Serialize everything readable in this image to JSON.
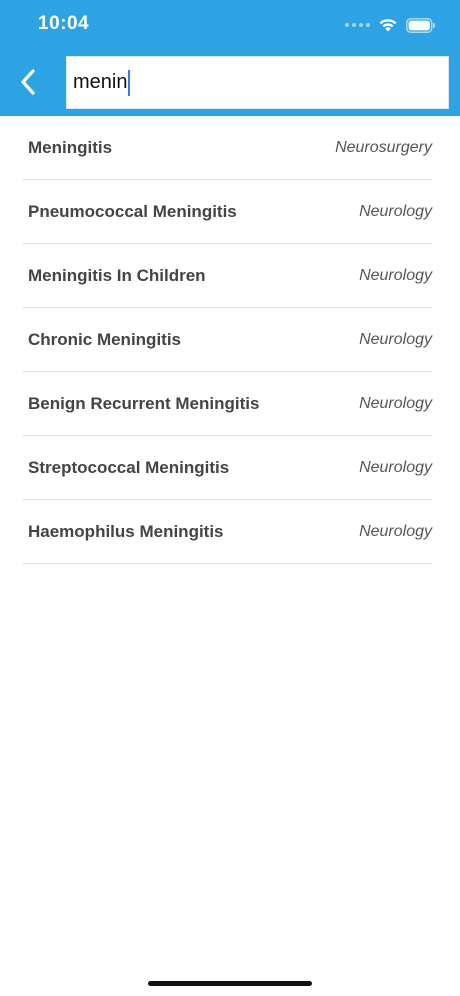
{
  "status_bar": {
    "time": "10:04"
  },
  "header": {
    "background_color": "#2ea3e3",
    "back_icon": "chevron-left-icon"
  },
  "search": {
    "value": "menin"
  },
  "results": [
    {
      "title": "Meningitis",
      "specialty": "Neurosurgery"
    },
    {
      "title": "Pneumococcal Meningitis",
      "specialty": "Neurology"
    },
    {
      "title": "Meningitis In Children",
      "specialty": "Neurology"
    },
    {
      "title": "Chronic Meningitis",
      "specialty": "Neurology"
    },
    {
      "title": "Benign Recurrent Meningitis",
      "specialty": "Neurology"
    },
    {
      "title": "Streptococcal Meningitis",
      "specialty": "Neurology"
    },
    {
      "title": "Haemophilus Meningitis",
      "specialty": "Neurology"
    }
  ]
}
